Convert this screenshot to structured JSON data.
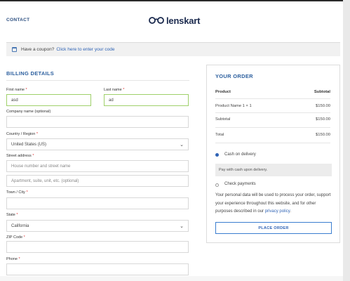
{
  "header": {
    "contact_label": "CONTACT",
    "logo_text": "lenskart"
  },
  "coupon": {
    "text": "Have a coupon?",
    "link": "Click here to enter your code"
  },
  "billing": {
    "title": "BILLING DETAILS",
    "first_name": {
      "label": "First name",
      "value": "asd"
    },
    "last_name": {
      "label": "Last name",
      "value": "ad"
    },
    "company": {
      "label": "Company name (optional)",
      "value": ""
    },
    "country": {
      "label": "Country / Region",
      "value": "United States (US)"
    },
    "street": {
      "label": "Street address",
      "placeholder1": "House number and street name",
      "placeholder2": "Apartment, suite, unit, etc. (optional)"
    },
    "city": {
      "label": "Town / City",
      "value": ""
    },
    "state": {
      "label": "State",
      "value": "California"
    },
    "zip": {
      "label": "ZIP Code",
      "value": ""
    },
    "phone": {
      "label": "Phone",
      "value": ""
    },
    "required_mark": "*"
  },
  "order": {
    "title": "YOUR ORDER",
    "col_product": "Product",
    "col_subtotal": "Subtotal",
    "item_name": "Product Name 1 × 1",
    "item_price": "$150.00",
    "subtotal_label": "Subtotal",
    "subtotal_value": "$150.00",
    "total_label": "Total",
    "total_value": "$150.00"
  },
  "payment": {
    "cod_label": "Cash on delivery",
    "cod_desc": "Pay with cash upon delivery.",
    "check_label": "Check payments",
    "privacy_text": "Your personal data will be used to process your order, support your experience throughout this website, and for other purposes described in our",
    "privacy_link": "privacy policy",
    "privacy_end": ".",
    "place_order": "PLACE ORDER"
  },
  "colors": {
    "accent": "#2f63b5",
    "valid_border": "#9fd06a"
  }
}
